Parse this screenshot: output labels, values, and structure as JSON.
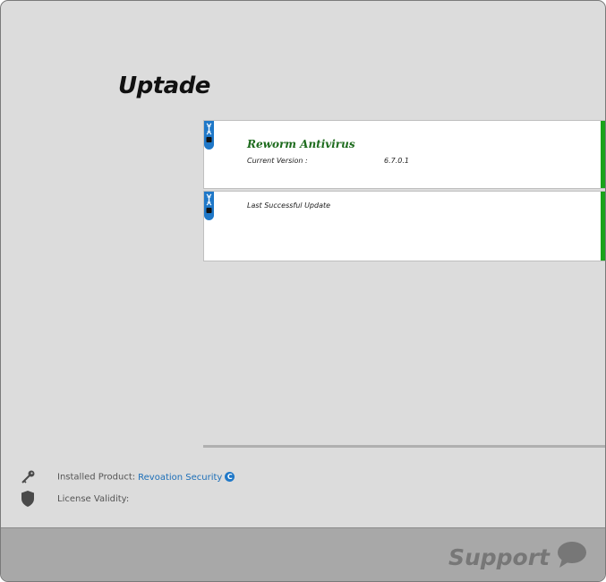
{
  "page": {
    "title": "Uptade"
  },
  "cards": [
    {
      "product_name": "Reworm Antivirus",
      "version_label": "Current Version :",
      "version_value": "6.7.0.1",
      "badge_icon": "dna-icon"
    },
    {
      "update_label": "Last Successful Update",
      "badge_icon": "dna-icon"
    }
  ],
  "info": {
    "installed_label": "Installed Product:",
    "installed_value": "Revoation Security",
    "installed_badge": "C",
    "license_label": "License Validity:",
    "key_icon": "key-icon",
    "shield_icon": "shield-icon"
  },
  "footer": {
    "support_label": "Support",
    "chat_icon": "chat-bubble-icon"
  },
  "colors": {
    "background": "#dcdcdc",
    "accent_green": "#1aa31a",
    "product_green": "#1d6b1d",
    "badge_blue": "#1f78c8",
    "link_blue": "#1d6fb8",
    "footer_gray": "#a8a8a8"
  }
}
